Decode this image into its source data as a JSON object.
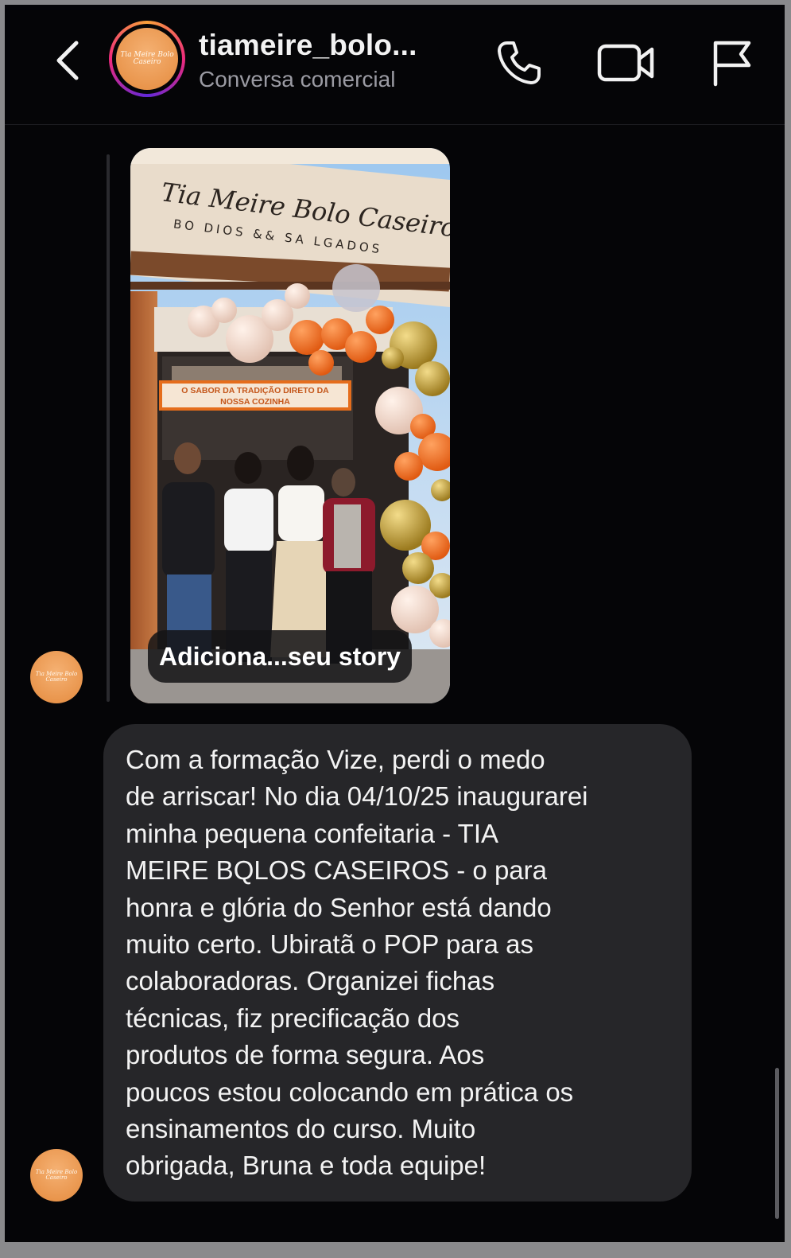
{
  "header": {
    "title": "tiameire_bolo...",
    "subtitle": "Conversa comercial",
    "icons": [
      "back-icon",
      "phone-icon",
      "video-icon",
      "flag-icon"
    ],
    "avatar_logo_text": "Tia Meire Bolo Caseiro"
  },
  "story": {
    "pill_label": "Adiciona...seu story",
    "sign_main": "Tia Meire Bolo Caseiro",
    "sign_sub": "BO DIOS && SA LGADOS",
    "banner_line1": "O SABOR DA TRADIÇÃO DIRETO DA",
    "banner_line2": "NOSSA COZINHA"
  },
  "message": {
    "text": "Com a formação Vize, perdi o medo\nde arriscar! No dia 04/10/25 inaugurarei\nminha pequena confeitaria - TIA\nMEIRE BQLOS CASEIROS -  o para\nhonra e glória do Senhor está dando\nmuito certo. Ubiratã o POP para as\ncolaboradoras. Organizei fichas\ntécnicas, fiz precificação dos\nprodutos de forma segura. Aos\npoucos estou colocando em prática os\nensinamentos do curso. Muito\nobrigada,  Bruna e toda equipe!"
  },
  "colors": {
    "background": "#050507",
    "bubble": "#262629",
    "brand_orange": "#e48a3d"
  }
}
